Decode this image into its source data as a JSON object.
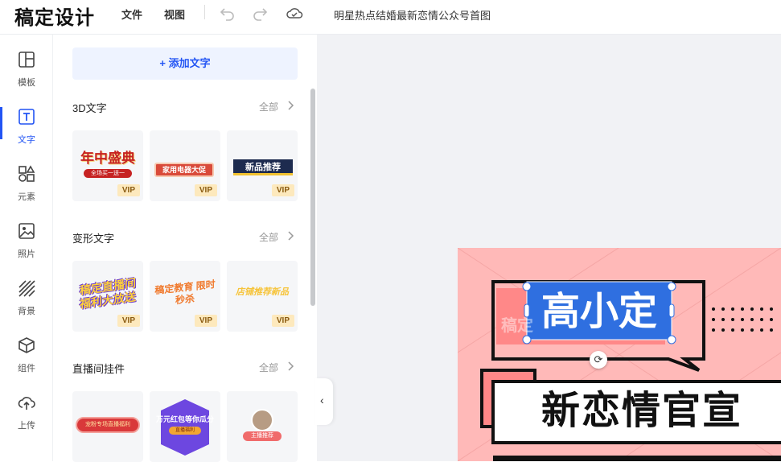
{
  "app": {
    "logo": "稿定设计",
    "menu_file": "文件",
    "menu_view": "视图",
    "document_title": "明星热点结婚最新恋情公众号首图",
    "accent": "#2254f4"
  },
  "toolbar": {
    "undo_icon": "undo-icon",
    "redo_icon": "redo-icon",
    "cloud_icon": "cloud-saved-icon"
  },
  "rail": {
    "items": [
      {
        "label": "模板",
        "icon": "template-icon"
      },
      {
        "label": "文字",
        "icon": "text-icon"
      },
      {
        "label": "元素",
        "icon": "elements-icon"
      },
      {
        "label": "照片",
        "icon": "photo-icon"
      },
      {
        "label": "背景",
        "icon": "background-icon"
      },
      {
        "label": "组件",
        "icon": "component-icon"
      },
      {
        "label": "上传",
        "icon": "upload-icon"
      }
    ],
    "active": "文字"
  },
  "panel": {
    "add_text": "+ 添加文字",
    "see_all": "全部",
    "sections": [
      {
        "title": "3D文字",
        "thumbs": [
          {
            "text": "年中盛典",
            "sub": "全场买一送一",
            "vip": "VIP"
          },
          {
            "text": "家用电器大促",
            "vip": "VIP"
          },
          {
            "text": "新品推荐",
            "vip": "VIP"
          }
        ]
      },
      {
        "title": "变形文字",
        "thumbs": [
          {
            "text": "稿定直播间 福利大放送",
            "vip": "VIP"
          },
          {
            "text": "稿定教育 限时秒杀",
            "vip": "VIP"
          },
          {
            "text": "店铺推荐新品",
            "vip": "VIP"
          }
        ]
      },
      {
        "title": "直播间挂件",
        "thumbs": [
          {
            "text": "宠粉专场直播福利"
          },
          {
            "text": "万元红包等你瓜分",
            "sub": "直播福利"
          },
          {
            "text": "主播推荐"
          }
        ]
      }
    ]
  },
  "artboard": {
    "selected_text": "高小定",
    "headline": "新恋情官宣",
    "faded_text": "稿定"
  }
}
